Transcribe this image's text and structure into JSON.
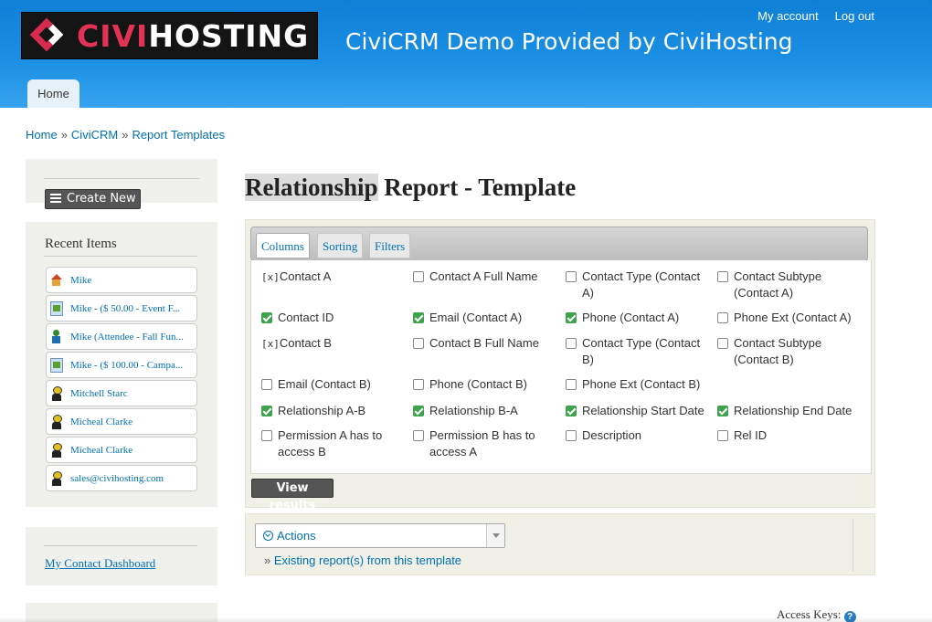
{
  "header": {
    "logo_part1": "CIVI",
    "logo_part2": "HOSTING",
    "site_name": "CiviCRM Demo Provided by CiviHosting",
    "my_account": "My account",
    "log_out": "Log out",
    "home_tab": "Home"
  },
  "breadcrumb": {
    "items": [
      "Home",
      "CiviCRM",
      "Report Templates"
    ],
    "separator": "»"
  },
  "sidebar": {
    "create_new": "Create New",
    "recent_title": "Recent Items",
    "recent_items": [
      {
        "label": "Mike",
        "icon": "home-icon"
      },
      {
        "label": "Mike - ($ 50.00 - Event F...",
        "icon": "contribution-icon"
      },
      {
        "label": "Mike (Attendee - Fall Fun...",
        "icon": "participant-icon"
      },
      {
        "label": "Mike - ($ 100.00 - Campa...",
        "icon": "contribution-icon"
      },
      {
        "label": "Mitchell Starc",
        "icon": "individual-icon"
      },
      {
        "label": "Micheal Clarke",
        "icon": "individual-icon"
      },
      {
        "label": "Micheal Clarke",
        "icon": "individual-icon"
      },
      {
        "label": "sales@civihosting.com",
        "icon": "individual-icon"
      }
    ],
    "dashboard_link": "My Contact Dashboard"
  },
  "main": {
    "title_highlight": "Relationship",
    "title_rest": " Report - Template",
    "tabs": [
      "Columns",
      "Sorting",
      "Filters"
    ],
    "active_tab": "Columns",
    "columns": [
      {
        "label": "Contact A",
        "state": "required",
        "mark": "[x]"
      },
      {
        "label": "Contact A Full Name",
        "state": "unchecked"
      },
      {
        "label": "Contact Type (Contact A)",
        "state": "unchecked"
      },
      {
        "label": "Contact Subtype (Contact A)",
        "state": "unchecked"
      },
      {
        "label": "Contact ID",
        "state": "checked"
      },
      {
        "label": "Email (Contact A)",
        "state": "checked"
      },
      {
        "label": "Phone (Contact A)",
        "state": "checked"
      },
      {
        "label": "Phone Ext (Contact A)",
        "state": "unchecked"
      },
      {
        "label": "Contact B",
        "state": "required",
        "mark": "[x]"
      },
      {
        "label": "Contact B Full Name",
        "state": "unchecked"
      },
      {
        "label": "Contact Type (Contact B)",
        "state": "unchecked"
      },
      {
        "label": "Contact Subtype (Contact B)",
        "state": "unchecked"
      },
      {
        "label": "Email (Contact B)",
        "state": "unchecked"
      },
      {
        "label": "Phone (Contact B)",
        "state": "unchecked"
      },
      {
        "label": "Phone Ext (Contact B)",
        "state": "unchecked"
      },
      {
        "label": "",
        "state": "empty"
      },
      {
        "label": "Relationship A-B",
        "state": "checked"
      },
      {
        "label": "Relationship B-A",
        "state": "checked"
      },
      {
        "label": "Relationship Start Date",
        "state": "checked"
      },
      {
        "label": "Relationship End Date",
        "state": "checked"
      },
      {
        "label": "Permission A has to access B",
        "state": "unchecked"
      },
      {
        "label": "Permission B has to access A",
        "state": "unchecked"
      },
      {
        "label": "Description",
        "state": "unchecked"
      },
      {
        "label": "Rel ID",
        "state": "unchecked"
      }
    ],
    "view_results": "View results",
    "actions_label": "Actions",
    "existing_prefix": "»",
    "existing_link": "Existing report(s) from this template",
    "access_keys": "Access Keys:",
    "help_glyph": "?"
  },
  "colors": {
    "header_blue": "#1a8fe3",
    "link_blue": "#0071b3",
    "brand_red": "#e23256",
    "check_green": "#3fa34d"
  }
}
